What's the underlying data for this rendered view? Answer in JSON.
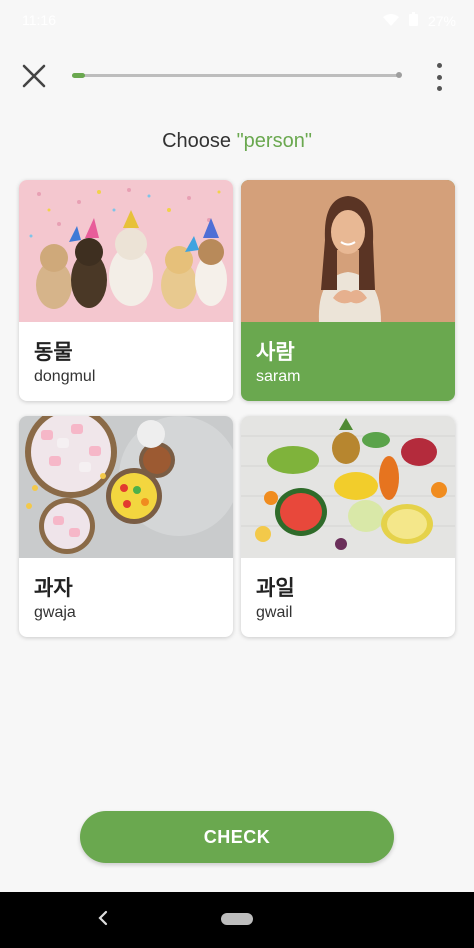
{
  "status_bar": {
    "time": "11:16",
    "battery": "27%"
  },
  "header": {
    "close_icon": "close-icon",
    "progress_fraction": 0.04,
    "more_icon": "more-vert-icon"
  },
  "prompt": {
    "prefix": "Choose ",
    "target": "\"person\""
  },
  "choices": [
    {
      "word": "동물",
      "romanization": "dongmul",
      "image": "dogs-party-image",
      "selected": false
    },
    {
      "word": "사람",
      "romanization": "saram",
      "image": "woman-portrait-image",
      "selected": true
    },
    {
      "word": "과자",
      "romanization": "gwaja",
      "image": "snacks-image",
      "selected": false
    },
    {
      "word": "과일",
      "romanization": "gwail",
      "image": "fruits-image",
      "selected": false
    }
  ],
  "check_button": {
    "label": "CHECK"
  },
  "colors": {
    "accent": "#6aa84f",
    "background": "#f7f7f7"
  }
}
